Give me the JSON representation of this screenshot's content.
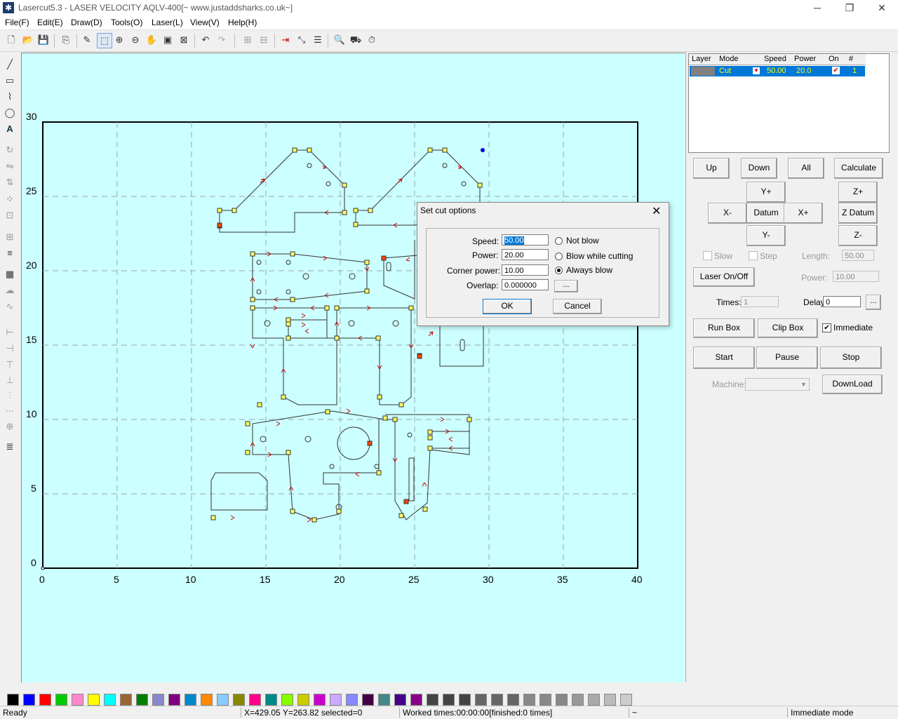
{
  "window": {
    "title": "Lasercut5.3 - LASER VELOCITY AQLV-400[~ www.justaddsharks.co.uk~]",
    "minimize": "─",
    "restore": "❐",
    "close": "✕"
  },
  "menu": [
    "File(F)",
    "Edit(E)",
    "Draw(D)",
    "Tools(O)",
    "Laser(L)",
    "View(V)",
    "Help(H)"
  ],
  "canvas": {
    "x_ticks": [
      "0",
      "5",
      "10",
      "15",
      "20",
      "25",
      "30",
      "35",
      "40"
    ],
    "y_ticks": [
      "0",
      "5",
      "10",
      "15",
      "20",
      "25",
      "30"
    ]
  },
  "layers": {
    "headers": [
      "Layer",
      "Mode",
      "Speed",
      "Power",
      "On",
      "#"
    ],
    "rows": [
      {
        "layer": "",
        "mode": "Cut",
        "speed": "50.00",
        "power": "20.0",
        "on": "✔",
        "num": "1"
      }
    ]
  },
  "panel": {
    "up": "Up",
    "down": "Down",
    "all": "All",
    "calculate": "Calculate",
    "yplus": "Y+",
    "zplus": "Z+",
    "xminus": "X-",
    "datum": "Datum",
    "xplus": "X+",
    "zdatum": "Z Datum",
    "yminus": "Y-",
    "zminus": "Z-",
    "slow": "Slow",
    "step": "Step",
    "length_label": "Length:",
    "length_value": "50.00",
    "laser_onoff": "Laser On/Off",
    "power_label": "Power:",
    "power_value": "10.00",
    "times_label": "Times:",
    "times_value": "1",
    "delay_label": "Delay:",
    "delay_value": "0",
    "delay_more": "...",
    "run_box": "Run Box",
    "clip_box": "Clip Box",
    "immediate": "Immediate",
    "start": "Start",
    "pause": "Pause",
    "stop": "Stop",
    "machine_label": "Machine:",
    "download": "DownLoad"
  },
  "dialog": {
    "title": "Set cut options",
    "speed_label": "Speed:",
    "speed_value": "50.00",
    "power_label": "Power:",
    "power_value": "20.00",
    "corner_label": "Corner power:",
    "corner_value": "10.00",
    "overlap_label": "Overlap:",
    "overlap_value": "0.000000",
    "overlap_more": "...",
    "opt_not_blow": "Not blow",
    "opt_blow_cutting": "Blow while cutting",
    "opt_always": "Always blow",
    "ok": "OK",
    "cancel": "Cancel"
  },
  "palette": [
    "#000000",
    "#0000ff",
    "#ff0000",
    "#00cc00",
    "#ff88cc",
    "#ffff00",
    "#00ffff",
    "#996633",
    "#008000",
    "#8888cc",
    "#800080",
    "#0088cc",
    "#ff8800",
    "#88ccff",
    "#888800",
    "#ff0088",
    "#008888",
    "#88ff00",
    "#cccc00",
    "#cc00cc",
    "#ccaaff",
    "#8888ff",
    "#440044",
    "#448888",
    "#440088",
    "#880088",
    "#444444",
    "#444444",
    "#444444",
    "#666666",
    "#666666",
    "#666666",
    "#888888",
    "#888888",
    "#888888",
    "#999999",
    "#aaaaaa",
    "#bbbbbb",
    "#cccccc"
  ],
  "status": {
    "ready": "Ready",
    "coords": "X=429.05 Y=263.82 selected=0",
    "worked": "Worked times:00:00:00[finished:0 times]",
    "tilde": "~",
    "mode": "Immediate mode"
  }
}
